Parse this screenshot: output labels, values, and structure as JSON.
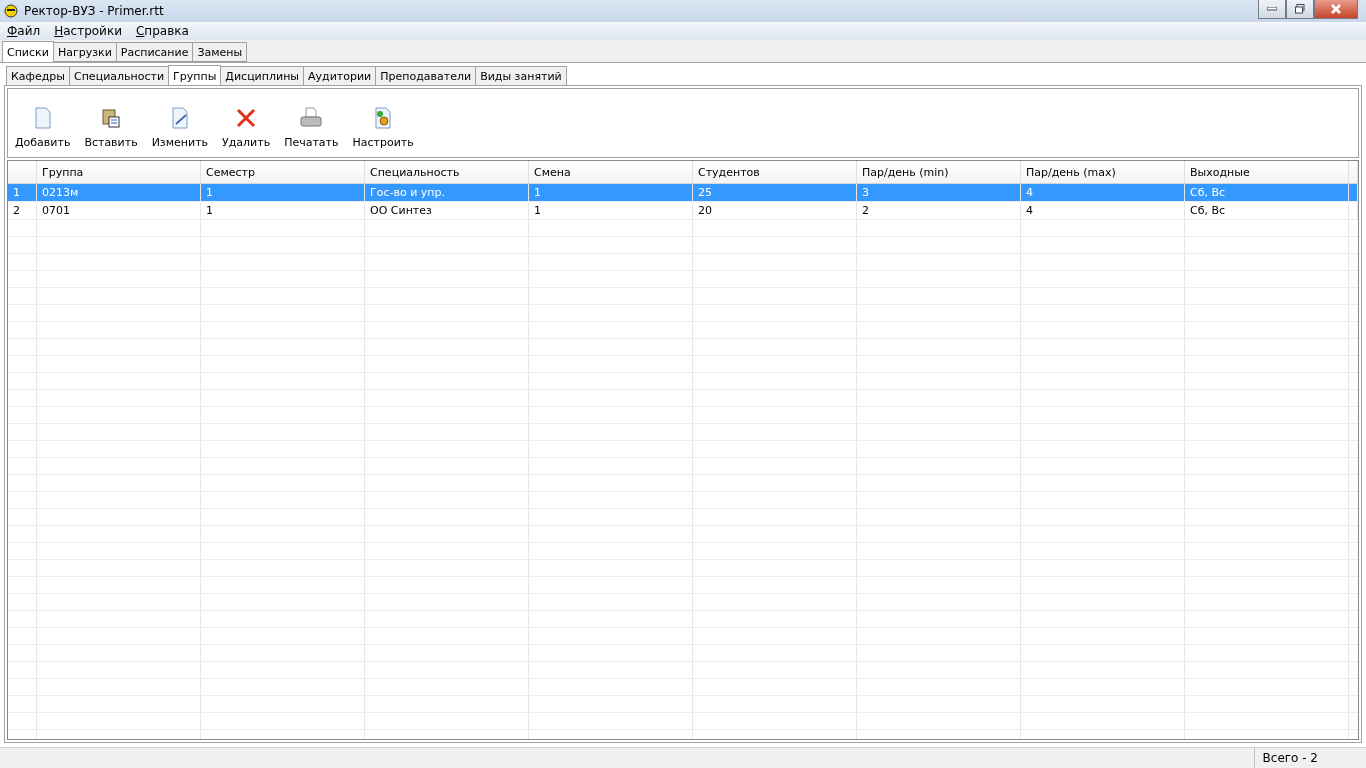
{
  "window": {
    "title": "Ректор-ВУЗ - Primer.rtt"
  },
  "menu": [
    "Файл",
    "Настройки",
    "Справка"
  ],
  "main_tabs": [
    {
      "label": "Списки",
      "selected": true
    },
    {
      "label": "Нагрузки",
      "selected": false
    },
    {
      "label": "Расписание",
      "selected": false
    },
    {
      "label": "Замены",
      "selected": false
    }
  ],
  "sub_tabs": [
    {
      "label": "Кафедры",
      "selected": false
    },
    {
      "label": "Специальности",
      "selected": false
    },
    {
      "label": "Группы",
      "selected": true
    },
    {
      "label": "Дисциплины",
      "selected": false
    },
    {
      "label": "Аудитории",
      "selected": false
    },
    {
      "label": "Преподаватели",
      "selected": false
    },
    {
      "label": "Виды занятий",
      "selected": false
    }
  ],
  "toolbar": [
    {
      "kind": "new",
      "label": "Добавить"
    },
    {
      "kind": "paste",
      "label": "Вставить"
    },
    {
      "kind": "edit",
      "label": "Изменить"
    },
    {
      "kind": "delete",
      "label": "Удалить"
    },
    {
      "kind": "print",
      "label": "Печатать"
    },
    {
      "kind": "settings",
      "label": "Настроить"
    }
  ],
  "table": {
    "columns": [
      "Группа",
      "Семестр",
      "Специальность",
      "Смена",
      "Студентов",
      "Пар/день (min)",
      "Пар/день (max)",
      "Выходные"
    ],
    "rows": [
      {
        "number": "1",
        "selected": true,
        "cells": [
          "0213м",
          "1",
          "Гос-во и упр.",
          "1",
          "25",
          "3",
          "4",
          "Сб, Вс"
        ]
      },
      {
        "number": "2",
        "selected": false,
        "cells": [
          "0701",
          "1",
          "ОО Синтез",
          "1",
          "20",
          "2",
          "4",
          "Сб, Вс"
        ]
      }
    ]
  },
  "status_bar": {
    "total": "Всего - 2"
  }
}
